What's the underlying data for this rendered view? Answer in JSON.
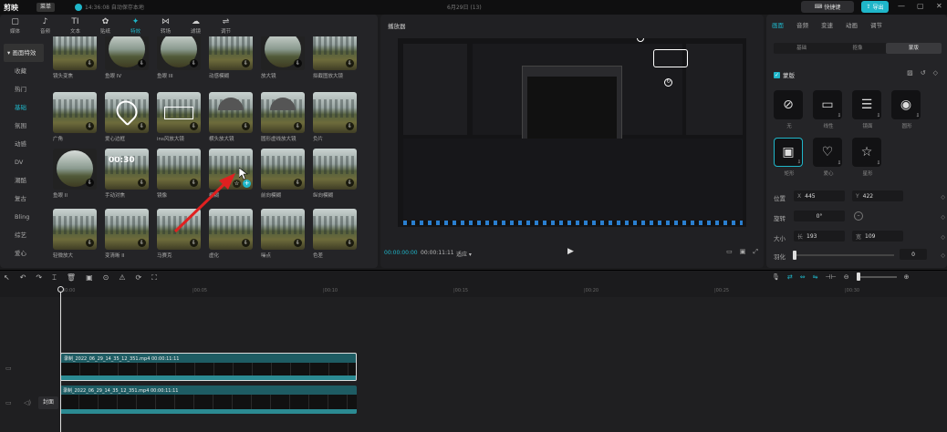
{
  "topbar": {
    "logo": "剪映",
    "menu": "菜单",
    "status": "14:36:08 自动保存本地",
    "title": "6月29日 (13)",
    "shortcut": "快捷键",
    "export": "导出"
  },
  "tools": [
    {
      "icon": "▢",
      "label": "媒体"
    },
    {
      "icon": "♪",
      "label": "音频"
    },
    {
      "icon": "TI",
      "label": "文本"
    },
    {
      "icon": "✿",
      "label": "贴纸"
    },
    {
      "icon": "✦",
      "label": "特效"
    },
    {
      "icon": "⋈",
      "label": "转场"
    },
    {
      "icon": "☁",
      "label": "滤镜"
    },
    {
      "icon": "⇌",
      "label": "调节"
    }
  ],
  "sidebar": {
    "header": "▾ 画面特效",
    "items": [
      "收藏",
      "热门",
      "基础",
      "氛围",
      "动感",
      "DV",
      "潮酷",
      "复古",
      "Bling",
      "综艺",
      "爱心"
    ]
  },
  "effects": [
    [
      "镜头变焦",
      "鱼眼 IV",
      "鱼眼 III",
      "动感模糊",
      "放大镜",
      "拟截图放大镜"
    ],
    [
      "广角",
      "爱心边框",
      "ins风放大镜",
      "横头放大镜",
      "圆形虚线放大镜",
      "负片"
    ],
    [
      "鱼眼 II",
      "手动对焦",
      "镜像",
      "模糊",
      "前向模糊",
      "纵向模糊"
    ],
    [
      "轻微放大",
      "变清晰 II",
      "马赛克",
      "虚化",
      "噪点",
      "色差"
    ]
  ],
  "effect_timer_text": "00:30",
  "player": {
    "title": "播放器",
    "current": "00:00:00:00",
    "total": "00:00:11:11",
    "ratio": "适应 ▾"
  },
  "inspector": {
    "tabs": [
      "画面",
      "音频",
      "变速",
      "动画",
      "调节"
    ],
    "sub_tabs": [
      "基础",
      "抠像",
      "蒙版"
    ],
    "mask_toggle": "蒙版",
    "masks": [
      {
        "icon": "⊘",
        "label": "无"
      },
      {
        "icon": "▭",
        "label": "线性"
      },
      {
        "icon": "☰",
        "label": "镜面"
      },
      {
        "icon": "◉",
        "label": "圆形"
      },
      {
        "icon": "▣",
        "label": "矩形"
      },
      {
        "icon": "♡",
        "label": "爱心"
      },
      {
        "icon": "☆",
        "label": "星形"
      }
    ],
    "position_label": "位置",
    "pos_x": "445",
    "pos_y": "422",
    "x_prefix": "X",
    "y_prefix": "Y",
    "rotate_label": "旋转",
    "rotate_value": "0°",
    "size_label": "大小",
    "size_w_prefix": "长",
    "size_w": "193",
    "size_h_prefix": "宽",
    "size_h": "109",
    "feather_label": "羽化",
    "feather_value": "0"
  },
  "timeline": {
    "ticks": [
      "00:00",
      "|00:05",
      "|00:10",
      "|00:15",
      "|00:20",
      "|00:25",
      "|00:30"
    ],
    "clip1": "录制_2022_06_29_14_35_12_351.mp4   00:00:11:11",
    "clip2": "录制_2022_06_29_14_35_12_351.mp4   00:00:11:11",
    "cover": "封面"
  },
  "colors": {
    "accent": "#1fb6c9",
    "arrow": "#e02020",
    "clip": "#1e5c63"
  }
}
